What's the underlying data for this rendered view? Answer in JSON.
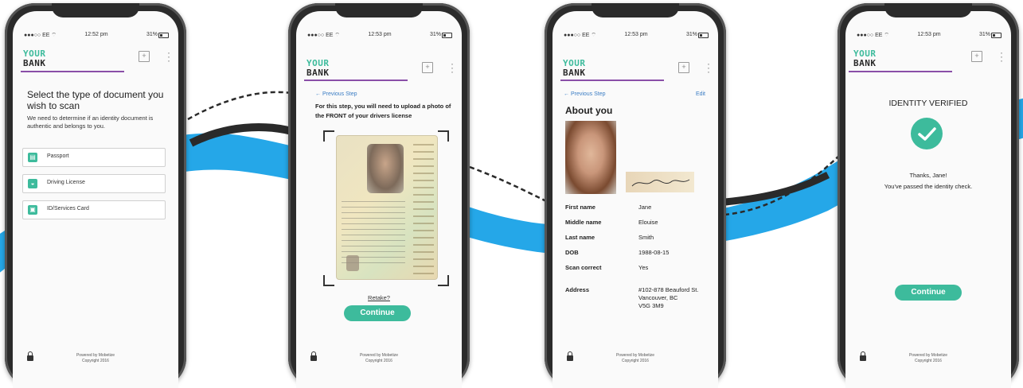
{
  "brand": {
    "line1": "YOUR",
    "line2": "BANK",
    "accent": "#3dbb9c",
    "bar": "#8a4fa8"
  },
  "lock_icon": "lock-icon",
  "phone1": {
    "status": {
      "carrier": "●●●○○ EE ⌔",
      "time": "12:52 pm",
      "battery": "31%"
    },
    "title": "Select the type of document you wish to scan",
    "subtitle": "We need to determine if an identity document is authentic and belongs to you.",
    "options": [
      {
        "icon": "passport-icon",
        "label": "Passport"
      },
      {
        "icon": "car-icon",
        "label": "Driving License"
      },
      {
        "icon": "id-card-icon",
        "label": "ID/Services Card"
      }
    ],
    "footer_1": "Powered by Mobetize",
    "footer_2": "Copyright 2016"
  },
  "phone2": {
    "status": {
      "carrier": "●●●○○ EE ⌔",
      "time": "12:53 pm",
      "battery": "31%"
    },
    "back": "← Previous Step",
    "instruction": "For this step, you will need to upload a photo of the FRONT of your drivers license",
    "retake": "Retake?",
    "continue": "Continue",
    "footer_1": "Powered by Mobetize",
    "footer_2": "Copyright 2016"
  },
  "phone3": {
    "status": {
      "carrier": "●●●○○ EE ⌔",
      "time": "12:53 pm",
      "battery": "31%"
    },
    "back": "← Previous Step",
    "edit": "Edit",
    "heading": "About you",
    "details": [
      {
        "label": "First name",
        "value": "Jane"
      },
      {
        "label": "Middle name",
        "value": "Elouise"
      },
      {
        "label": "Last name",
        "value": "Smith"
      },
      {
        "label": "DOB",
        "value": "1988-08-15"
      },
      {
        "label": "Scan correct",
        "value": "Yes"
      }
    ],
    "address_label": "Address",
    "address_lines": [
      "#102-878 Beauford St.",
      "Vancouver, BC",
      "V5G 3M9"
    ],
    "footer_1": "Powered by Mobetize",
    "footer_2": "Copyright 2016"
  },
  "phone4": {
    "status": {
      "carrier": "●●●○○ EE ⌔",
      "time": "12:53 pm",
      "battery": "31%"
    },
    "title": "IDENTITY VERIFIED",
    "thanks": "Thanks, Jane!",
    "message": "You've passed the identity check.",
    "continue": "Continue",
    "footer_1": "Powered by Mobetize",
    "footer_2": "Copyright 2016"
  }
}
